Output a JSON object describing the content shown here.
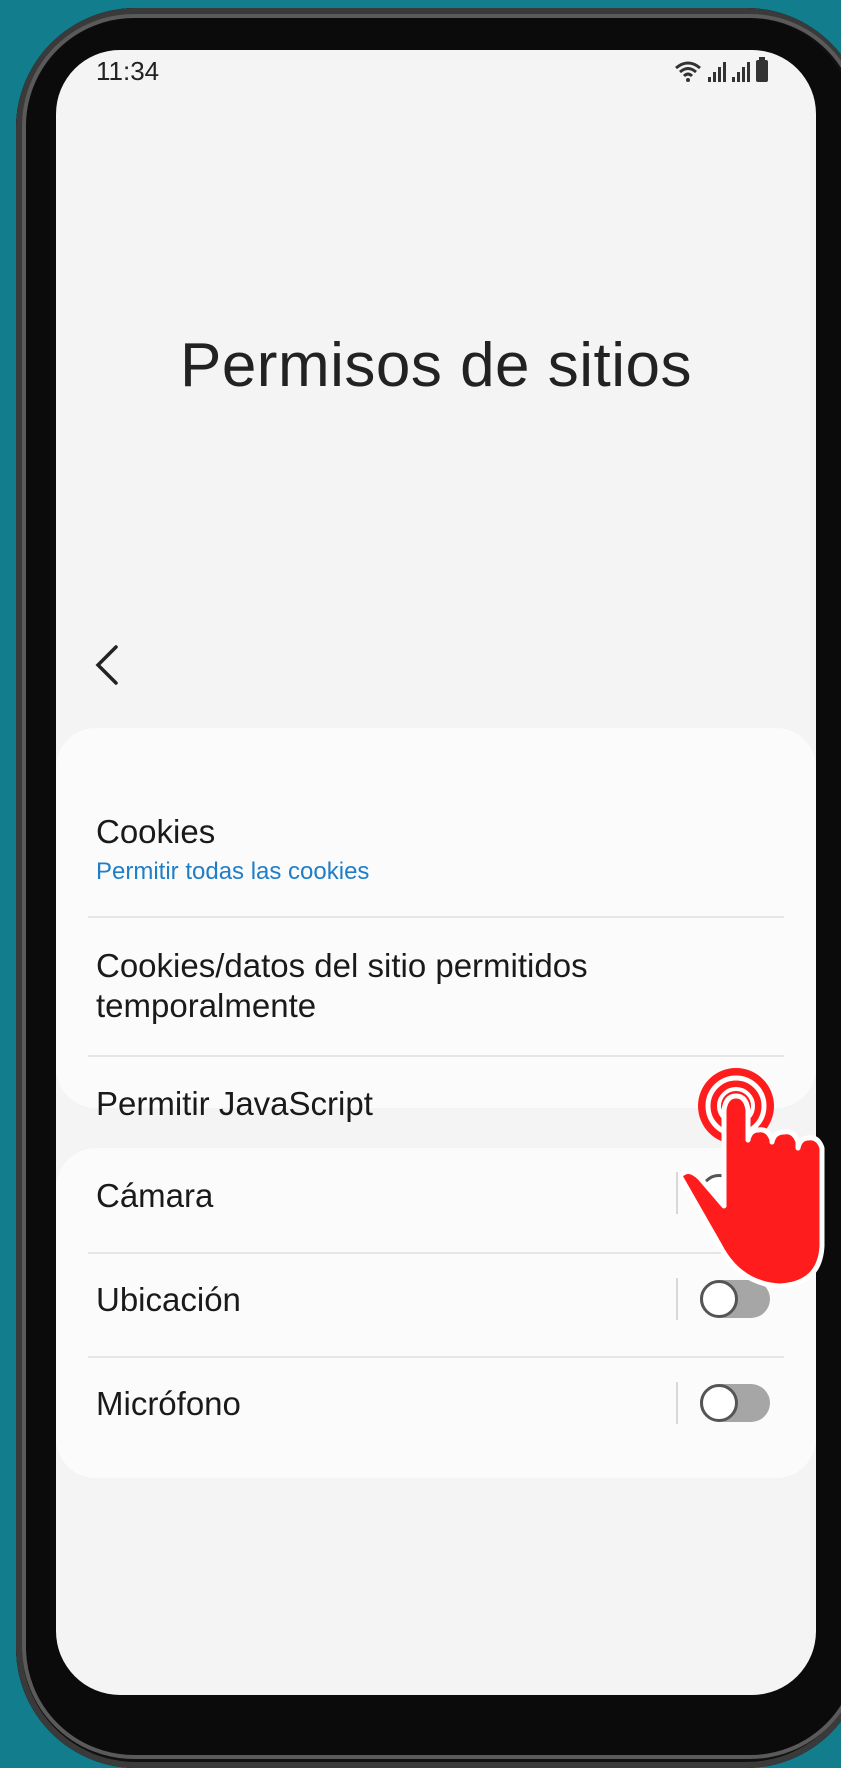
{
  "status_bar": {
    "time": "11:34"
  },
  "page": {
    "title": "Permisos de sitios"
  },
  "section_top": {
    "cookies": {
      "label": "Cookies",
      "value": "Permitir todas las cookies"
    },
    "temp_cookies": {
      "label": "Cookies/datos del sitio permitidos temporalmente"
    },
    "javascript": {
      "label": "Permitir JavaScript",
      "enabled": true
    }
  },
  "section_permissions": {
    "items": [
      {
        "label": "Cámara",
        "enabled": false
      },
      {
        "label": "Ubicación",
        "enabled": false
      },
      {
        "label": "Micrófono",
        "enabled": false
      }
    ]
  },
  "colors": {
    "background": "#127d8c",
    "accent": "#1a82e6",
    "link": "#1f7ec8",
    "tap_indicator": "#ff1c1c"
  }
}
